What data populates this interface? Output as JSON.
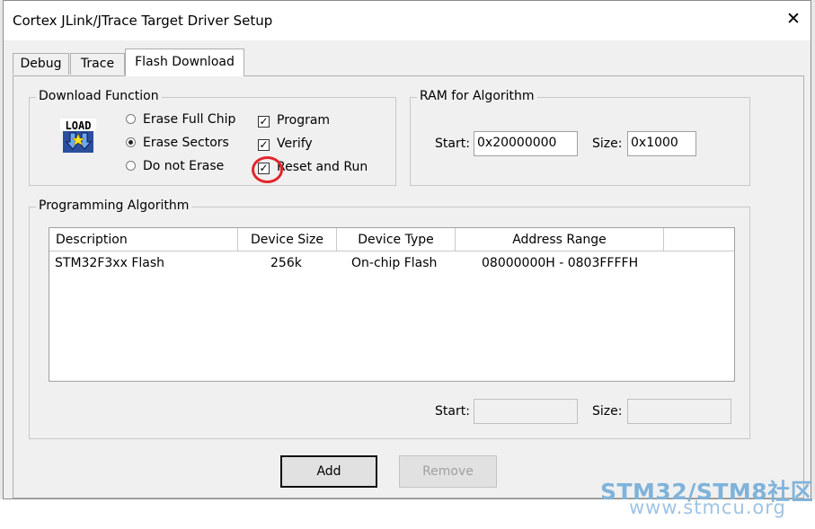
{
  "window": {
    "title": "Cortex JLink/JTrace Target Driver Setup",
    "close_glyph": "✕"
  },
  "tabs": [
    {
      "label": "Debug",
      "active": false
    },
    {
      "label": "Trace",
      "active": false
    },
    {
      "label": "Flash Download",
      "active": true
    }
  ],
  "download_function": {
    "title": "Download Function",
    "icon": "load-icon",
    "icon_text": "LOAD",
    "radios": [
      {
        "label": "Erase Full Chip",
        "checked": false
      },
      {
        "label": "Erase Sectors",
        "checked": true
      },
      {
        "label": "Do not Erase",
        "checked": false
      }
    ],
    "checkboxes": [
      {
        "label": "Program",
        "checked": true
      },
      {
        "label": "Verify",
        "checked": true
      },
      {
        "label": "Reset and Run",
        "checked": true
      }
    ],
    "check_glyph": "✓"
  },
  "ram": {
    "title": "RAM for Algorithm",
    "start_label": "Start:",
    "start_value": "0x20000000",
    "size_label": "Size:",
    "size_value": "0x1000"
  },
  "programming_algorithm": {
    "title": "Programming Algorithm",
    "columns": [
      "Description",
      "Device Size",
      "Device Type",
      "Address Range"
    ],
    "rows": [
      [
        "STM32F3xx Flash",
        "256k",
        "On-chip Flash",
        "08000000H - 0803FFFFH"
      ]
    ],
    "start_label": "Start:",
    "start_value": "",
    "size_label": "Size:",
    "size_value": ""
  },
  "buttons": {
    "add": "Add",
    "remove": "Remove"
  },
  "annotation": {
    "color": "#e3252a"
  },
  "watermark": {
    "line1": "STM32/STM8社区",
    "line2": "www.stmcu.org"
  }
}
